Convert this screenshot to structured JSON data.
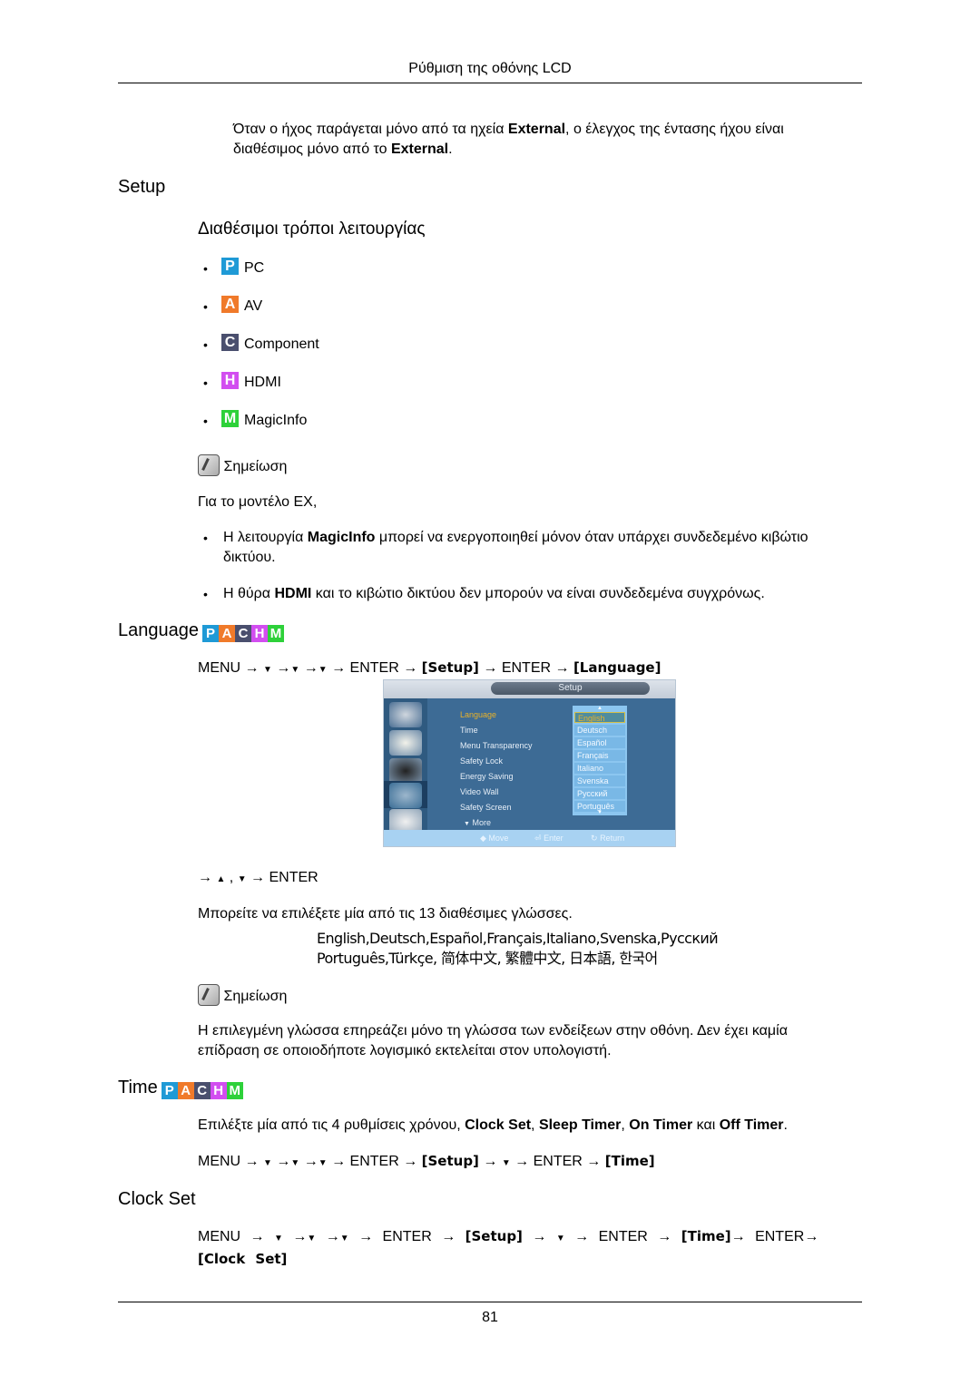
{
  "header": {
    "title": "Ρύθμιση της οθόνης LCD"
  },
  "intro": {
    "line1_a": "Όταν ο ήχος παράγεται μόνο από τα ηχεία ",
    "line1_b": "External",
    "line1_c": ", ο έλεγχος της έντασης ήχου είναι",
    "line2_a": "διαθέσιμος μόνο από το ",
    "line2_b": "External",
    "line2_c": "."
  },
  "setup": {
    "title": "Setup",
    "modes_title": "Διαθέσιμοι τρόποι λειτουργίας",
    "modes": [
      {
        "letter": "P",
        "label": "PC",
        "color": "#1f9ad6"
      },
      {
        "letter": "A",
        "label": "AV",
        "color": "#f07a2a"
      },
      {
        "letter": "C",
        "label": "Component",
        "color": "#4a4f6e"
      },
      {
        "letter": "H",
        "label": "HDMI",
        "color": "#d24ef0"
      },
      {
        "letter": "M",
        "label": "MagicInfo",
        "color": "#2ed13a"
      }
    ],
    "note_label": "Σημείωση",
    "note_model": "Για το μοντέλο EX,",
    "note_b1_a": "Η λειτουργία ",
    "note_b1_b": "MagicInfo",
    "note_b1_c": " μπορεί να ενεργοποιηθεί μόνον όταν υπάρχει συνδεδεμένο κιβώτιο",
    "note_b1_d": "δικτύου.",
    "note_b2_a": "Η θύρα ",
    "note_b2_b": "HDMI",
    "note_b2_c": " και το κιβώτιο δικτύου δεν μπορούν να είναι συνδεδεμένα συγχρόνως."
  },
  "badge": [
    "P",
    "A",
    "C",
    "H",
    "M"
  ],
  "language": {
    "title": "Language",
    "path": {
      "menu": "MENU",
      "enter": "ENTER",
      "setup": "[Setup]",
      "target": "[Language]"
    },
    "osd": {
      "title": "Setup",
      "items": [
        "Language",
        "Time",
        "Menu Transparency",
        "Safety Lock",
        "Energy Saving",
        "Video Wall",
        "Safety Screen"
      ],
      "more": "More",
      "options": [
        "English",
        "Deutsch",
        "Español",
        "Français",
        "Italiano",
        "Svenska",
        "Русский",
        "Português"
      ],
      "selected": "English",
      "hint_move": "Move",
      "hint_enter": "Enter",
      "hint_return": "Return"
    },
    "nav_enter": "ENTER",
    "available": "Μπορείτε να επιλέξετε μία από τις 13 διαθέσιμες γλώσσες.",
    "langs_line1": "English,Deutsch,Español,Français,Italiano,Svenska,Русский",
    "langs_line2": "Português,Türkçe, 简体中文,  繁體中文, 日本語, 한국어",
    "note_label": "Σημείωση",
    "note_text1": "Η επιλεγμένη γλώσσα επηρεάζει μόνο τη γλώσσα των ενδείξεων στην οθόνη. Δεν έχει καμία",
    "note_text2": "επίδραση σε οποιοδήποτε λογισμικό εκτελείται στον υπολογιστή."
  },
  "time": {
    "title": "Time",
    "desc_a": "Επιλέξτε μία από τις 4 ρυθμίσεις χρόνου, ",
    "desc_b": "Clock Set",
    "desc_c": ", ",
    "desc_d": "Sleep Timer",
    "desc_e": ", ",
    "desc_f": "On Timer",
    "desc_g": " και ",
    "desc_h": "Off Timer",
    "desc_i": ".",
    "path": {
      "menu": "MENU",
      "enter": "ENTER",
      "setup": "[Setup]",
      "target": "[Time]"
    }
  },
  "clockset": {
    "title": "Clock Set",
    "path": {
      "menu": "MENU",
      "enter": "ENTER",
      "setup": "[Setup]",
      "time": "[Time]",
      "target": "[Clock Set]"
    }
  },
  "footer": {
    "page": "81"
  }
}
